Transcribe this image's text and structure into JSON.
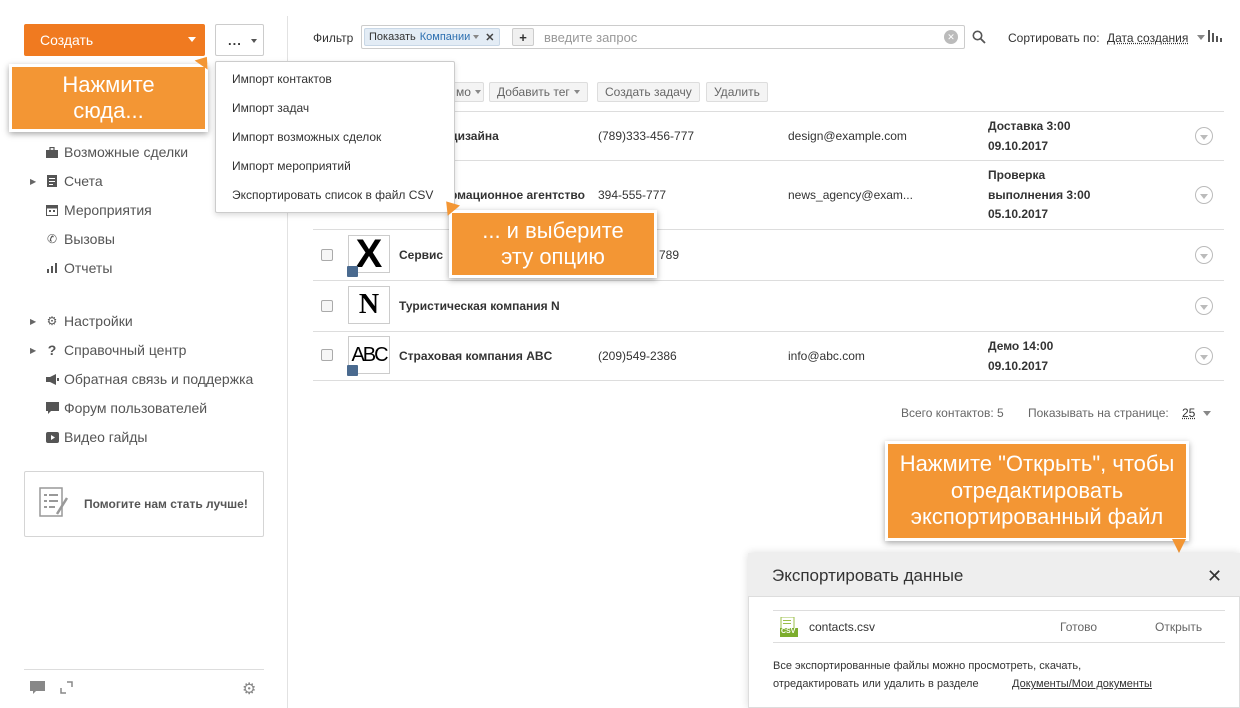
{
  "toolbar": {
    "create_label": "Создать",
    "more_label": "..."
  },
  "dropdown": {
    "items": [
      "Импорт контактов",
      "Импорт задач",
      "Импорт возможных сделок",
      "Импорт мероприятий",
      "Экспортировать список в файл CSV"
    ]
  },
  "sidebar": {
    "items": [
      {
        "label": "Возможные сделки",
        "icon": "briefcase-icon"
      },
      {
        "label": "Счета",
        "icon": "document-icon"
      },
      {
        "label": "Мероприятия",
        "icon": "calendar-icon"
      },
      {
        "label": "Вызовы",
        "icon": "phone-icon"
      },
      {
        "label": "Отчеты",
        "icon": "bar-chart-icon"
      }
    ],
    "secondary": [
      {
        "label": "Настройки",
        "icon": "gear-icon"
      },
      {
        "label": "Справочный центр",
        "icon": "question-icon"
      },
      {
        "label": "Обратная связь и поддержка",
        "icon": "megaphone-icon"
      },
      {
        "label": "Форум пользователей",
        "icon": "speech-bubble-icon"
      },
      {
        "label": "Видео гайды",
        "icon": "video-icon"
      }
    ],
    "improve_label": "Помогите нам стать лучше!"
  },
  "filter": {
    "label": "Фильтр",
    "chip_key": "Показать",
    "chip_value": "Компании",
    "placeholder": "введите запрос",
    "sort_label": "Сортировать по:",
    "sort_value": "Дата создания"
  },
  "actions": {
    "partial": "мо",
    "add_tag": "Добавить тег",
    "add_task": "Создать задачу",
    "delete": "Удалить"
  },
  "rows": [
    {
      "name": "дизайна",
      "phone": "(789)333-456-777",
      "email": "design@example.com",
      "task_line1": "Доставка 3:00",
      "task_line2": "09.10.2017"
    },
    {
      "name": "рмационное агентство",
      "phone": "394-555-777",
      "email": "news_agency@exam...",
      "task_line1": "Проверка",
      "task_line2": "выполнения 3:00",
      "task_line3": "05.10.2017"
    },
    {
      "name": "Сервис",
      "phone": "789",
      "email": "",
      "logo": "X"
    },
    {
      "name": "Туристическая компания N",
      "phone": "",
      "email": "",
      "logo": "N"
    },
    {
      "name": "Страховая компания ABC",
      "phone": "(209)549-2386",
      "email": "info@abc.com",
      "task_line1": "Демо 14:00",
      "task_line2": "09.10.2017",
      "logo": "ABC"
    }
  ],
  "footer": {
    "total": "Всего контактов: 5",
    "per_page_label": "Показывать на странице:",
    "per_page": "25"
  },
  "tips": {
    "tip1": "Нажмите сюда...",
    "tip2": "... и выберите эту опцию",
    "tip3": "Нажмите \"Открыть\", чтобы отредактировать экспортированный файл"
  },
  "export": {
    "title": "Экспортировать данные",
    "file_name": "contacts.csv",
    "file_icon_text": "CSV",
    "status": "Готово",
    "open": "Открыть",
    "info_line1": "Все экспортированные файлы можно просмотреть, скачать,",
    "info_line2": "отредактировать или удалить в разделе",
    "info_link": "Документы/Мои документы"
  },
  "colors": {
    "accent": "#f07a20",
    "tip": "#f39634",
    "link": "#2c6fb0"
  }
}
